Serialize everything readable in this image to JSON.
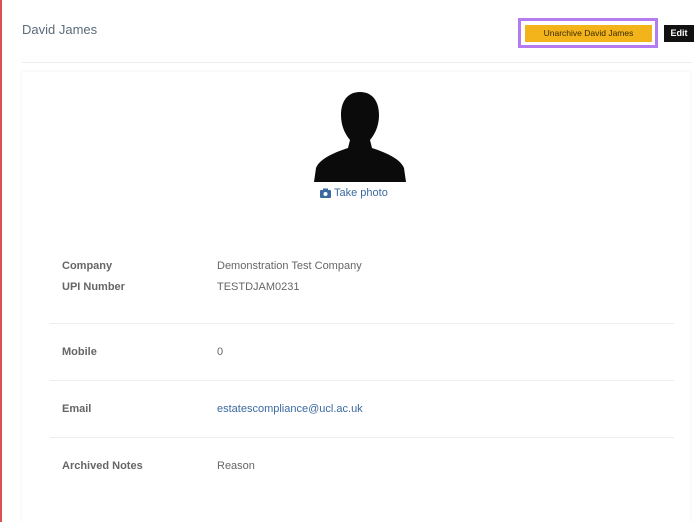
{
  "header": {
    "title": "David James",
    "unarchive_label": "Unarchive David James",
    "edit_label": "Edit"
  },
  "profile": {
    "take_photo_label": "Take photo"
  },
  "details": {
    "company_label": "Company",
    "company_value": "Demonstration Test Company",
    "upi_label": "UPI Number",
    "upi_value": "TESTDJAM0231",
    "mobile_label": "Mobile",
    "mobile_value": "0",
    "email_label": "Email",
    "email_value": "estatescompliance@ucl.ac.uk",
    "archived_notes_label": "Archived Notes",
    "archived_notes_value": "Reason"
  },
  "colors": {
    "unarchive_button": "#f2b31b",
    "edit_button": "#111111",
    "highlight": "#b57bf0",
    "link": "#3b6aa0"
  },
  "icons": [
    "user-silhouette-icon",
    "camera-icon"
  ]
}
